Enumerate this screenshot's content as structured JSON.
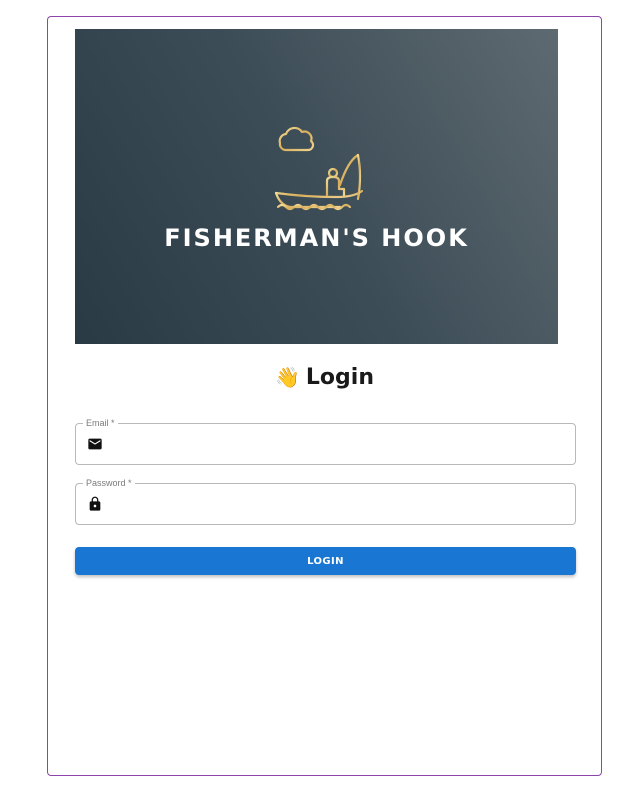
{
  "banner": {
    "brand_name": "FISHERMAN'S HOOK",
    "logo_icon": "fisherman-boat-icon",
    "gradient_dark": "#2a3a45",
    "gradient_light": "#5e6a71",
    "logo_color": "#e4c476"
  },
  "heading": {
    "emoji": "👋",
    "title": "Login"
  },
  "form": {
    "email_label": "Email *",
    "email_icon": "mail-icon",
    "email_value": "",
    "password_label": "Password *",
    "password_icon": "lock-icon",
    "password_value": ""
  },
  "button": {
    "label": "LOGIN",
    "color": "#1976d2"
  },
  "card": {
    "border_color": "#8e44ad"
  }
}
